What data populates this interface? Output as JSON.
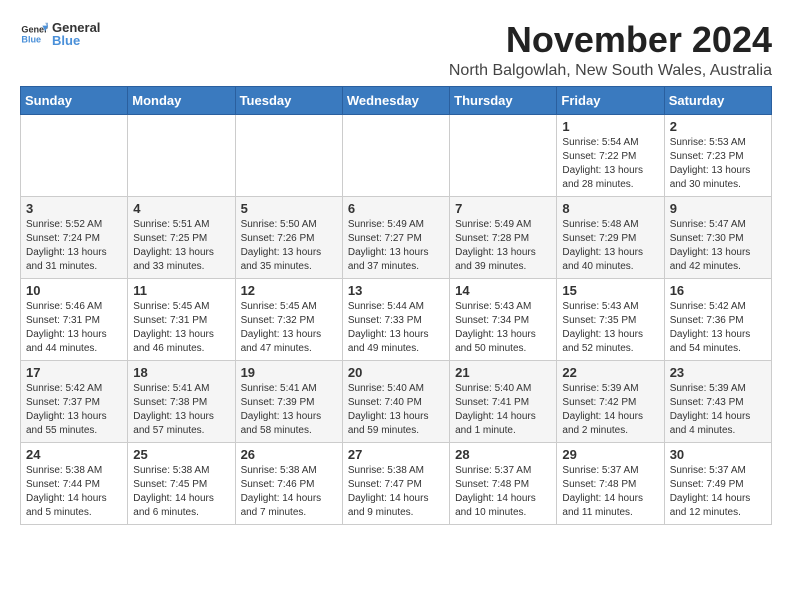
{
  "logo": {
    "general": "General",
    "blue": "Blue"
  },
  "title": "November 2024",
  "location": "North Balgowlah, New South Wales, Australia",
  "headers": [
    "Sunday",
    "Monday",
    "Tuesday",
    "Wednesday",
    "Thursday",
    "Friday",
    "Saturday"
  ],
  "weeks": [
    [
      {
        "day": "",
        "info": ""
      },
      {
        "day": "",
        "info": ""
      },
      {
        "day": "",
        "info": ""
      },
      {
        "day": "",
        "info": ""
      },
      {
        "day": "",
        "info": ""
      },
      {
        "day": "1",
        "info": "Sunrise: 5:54 AM\nSunset: 7:22 PM\nDaylight: 13 hours and 28 minutes."
      },
      {
        "day": "2",
        "info": "Sunrise: 5:53 AM\nSunset: 7:23 PM\nDaylight: 13 hours and 30 minutes."
      }
    ],
    [
      {
        "day": "3",
        "info": "Sunrise: 5:52 AM\nSunset: 7:24 PM\nDaylight: 13 hours and 31 minutes."
      },
      {
        "day": "4",
        "info": "Sunrise: 5:51 AM\nSunset: 7:25 PM\nDaylight: 13 hours and 33 minutes."
      },
      {
        "day": "5",
        "info": "Sunrise: 5:50 AM\nSunset: 7:26 PM\nDaylight: 13 hours and 35 minutes."
      },
      {
        "day": "6",
        "info": "Sunrise: 5:49 AM\nSunset: 7:27 PM\nDaylight: 13 hours and 37 minutes."
      },
      {
        "day": "7",
        "info": "Sunrise: 5:49 AM\nSunset: 7:28 PM\nDaylight: 13 hours and 39 minutes."
      },
      {
        "day": "8",
        "info": "Sunrise: 5:48 AM\nSunset: 7:29 PM\nDaylight: 13 hours and 40 minutes."
      },
      {
        "day": "9",
        "info": "Sunrise: 5:47 AM\nSunset: 7:30 PM\nDaylight: 13 hours and 42 minutes."
      }
    ],
    [
      {
        "day": "10",
        "info": "Sunrise: 5:46 AM\nSunset: 7:31 PM\nDaylight: 13 hours and 44 minutes."
      },
      {
        "day": "11",
        "info": "Sunrise: 5:45 AM\nSunset: 7:31 PM\nDaylight: 13 hours and 46 minutes."
      },
      {
        "day": "12",
        "info": "Sunrise: 5:45 AM\nSunset: 7:32 PM\nDaylight: 13 hours and 47 minutes."
      },
      {
        "day": "13",
        "info": "Sunrise: 5:44 AM\nSunset: 7:33 PM\nDaylight: 13 hours and 49 minutes."
      },
      {
        "day": "14",
        "info": "Sunrise: 5:43 AM\nSunset: 7:34 PM\nDaylight: 13 hours and 50 minutes."
      },
      {
        "day": "15",
        "info": "Sunrise: 5:43 AM\nSunset: 7:35 PM\nDaylight: 13 hours and 52 minutes."
      },
      {
        "day": "16",
        "info": "Sunrise: 5:42 AM\nSunset: 7:36 PM\nDaylight: 13 hours and 54 minutes."
      }
    ],
    [
      {
        "day": "17",
        "info": "Sunrise: 5:42 AM\nSunset: 7:37 PM\nDaylight: 13 hours and 55 minutes."
      },
      {
        "day": "18",
        "info": "Sunrise: 5:41 AM\nSunset: 7:38 PM\nDaylight: 13 hours and 57 minutes."
      },
      {
        "day": "19",
        "info": "Sunrise: 5:41 AM\nSunset: 7:39 PM\nDaylight: 13 hours and 58 minutes."
      },
      {
        "day": "20",
        "info": "Sunrise: 5:40 AM\nSunset: 7:40 PM\nDaylight: 13 hours and 59 minutes."
      },
      {
        "day": "21",
        "info": "Sunrise: 5:40 AM\nSunset: 7:41 PM\nDaylight: 14 hours and 1 minute."
      },
      {
        "day": "22",
        "info": "Sunrise: 5:39 AM\nSunset: 7:42 PM\nDaylight: 14 hours and 2 minutes."
      },
      {
        "day": "23",
        "info": "Sunrise: 5:39 AM\nSunset: 7:43 PM\nDaylight: 14 hours and 4 minutes."
      }
    ],
    [
      {
        "day": "24",
        "info": "Sunrise: 5:38 AM\nSunset: 7:44 PM\nDaylight: 14 hours and 5 minutes."
      },
      {
        "day": "25",
        "info": "Sunrise: 5:38 AM\nSunset: 7:45 PM\nDaylight: 14 hours and 6 minutes."
      },
      {
        "day": "26",
        "info": "Sunrise: 5:38 AM\nSunset: 7:46 PM\nDaylight: 14 hours and 7 minutes."
      },
      {
        "day": "27",
        "info": "Sunrise: 5:38 AM\nSunset: 7:47 PM\nDaylight: 14 hours and 9 minutes."
      },
      {
        "day": "28",
        "info": "Sunrise: 5:37 AM\nSunset: 7:48 PM\nDaylight: 14 hours and 10 minutes."
      },
      {
        "day": "29",
        "info": "Sunrise: 5:37 AM\nSunset: 7:48 PM\nDaylight: 14 hours and 11 minutes."
      },
      {
        "day": "30",
        "info": "Sunrise: 5:37 AM\nSunset: 7:49 PM\nDaylight: 14 hours and 12 minutes."
      }
    ]
  ]
}
